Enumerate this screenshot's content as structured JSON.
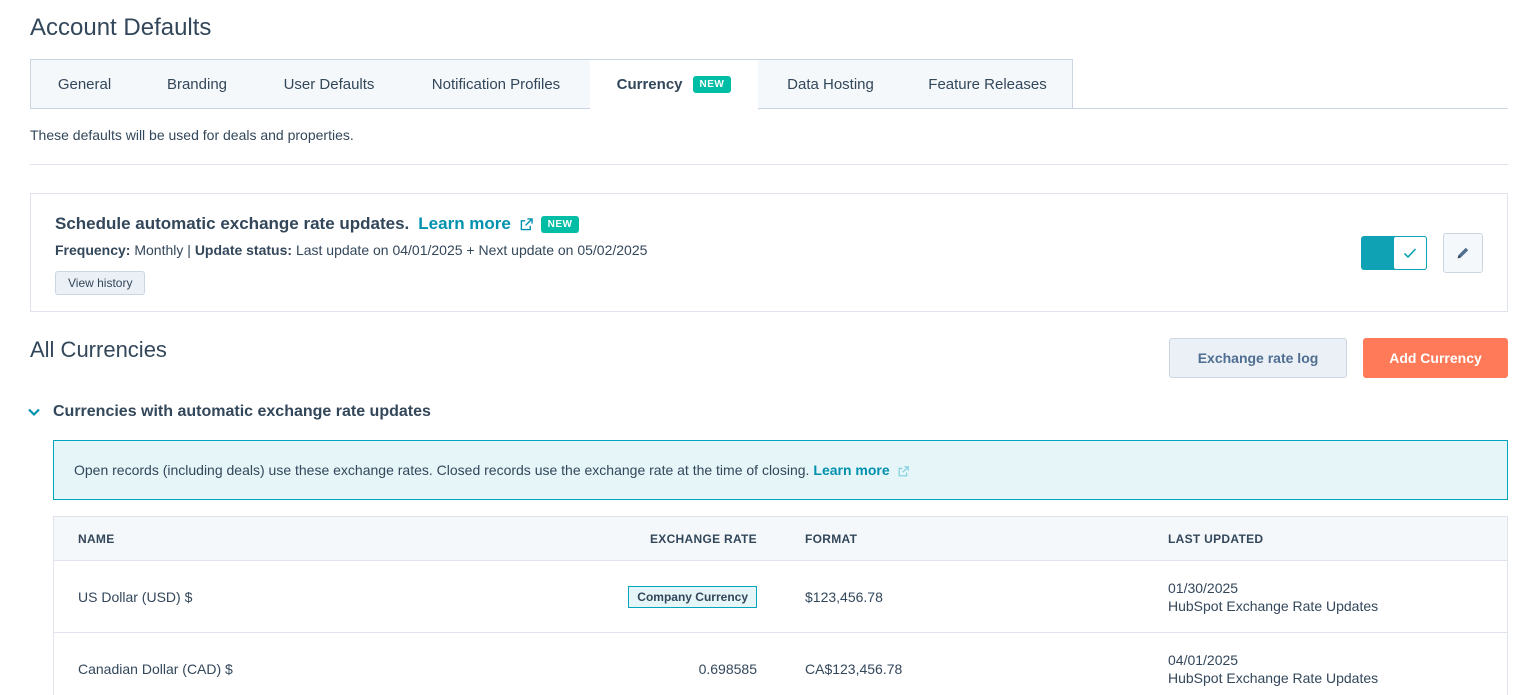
{
  "page": {
    "title": "Account Defaults"
  },
  "tabs": [
    {
      "label": "General"
    },
    {
      "label": "Branding"
    },
    {
      "label": "User Defaults"
    },
    {
      "label": "Notification Profiles"
    },
    {
      "label": "Currency",
      "badge": "NEW",
      "active": true
    },
    {
      "label": "Data Hosting"
    },
    {
      "label": "Feature Releases"
    }
  ],
  "subtext": "These defaults will be used for deals and properties.",
  "schedule": {
    "title": "Schedule automatic exchange rate updates.",
    "learn_more": "Learn more",
    "badge": "NEW",
    "frequency_label": "Frequency:",
    "frequency_value": "Monthly",
    "separator": "|",
    "status_label": "Update status:",
    "status_value": "Last update on 04/01/2025 + Next update on 05/02/2025",
    "view_history": "View history",
    "toggle_on": true
  },
  "currencies": {
    "title": "All Currencies",
    "exchange_log_button": "Exchange rate log",
    "add_button": "Add Currency",
    "section_label": "Currencies with automatic exchange rate updates",
    "info_text": "Open records (including deals) use these exchange rates. Closed records use the exchange rate at the time of closing.",
    "info_learn_more": "Learn more",
    "columns": {
      "name": "NAME",
      "rate": "EXCHANGE RATE",
      "format": "FORMAT",
      "updated": "LAST UPDATED"
    },
    "rows": [
      {
        "name": "US Dollar (USD) $",
        "rate": "Company Currency",
        "format": "$123,456.78",
        "date": "01/30/2025",
        "source": "HubSpot Exchange Rate Updates"
      },
      {
        "name": "Canadian Dollar (CAD) $",
        "rate": "0.698585",
        "format": "CA$123,456.78",
        "date": "04/01/2025",
        "source": "HubSpot Exchange Rate Updates"
      }
    ]
  },
  "colors": {
    "accent": "#0091ae",
    "primary_button": "#ff7a59",
    "badge": "#00bda5",
    "text": "#33475b"
  }
}
